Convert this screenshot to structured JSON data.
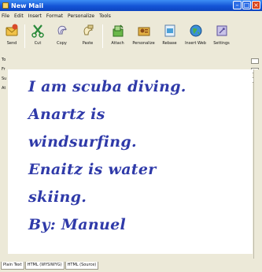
{
  "window": {
    "title": "New Mail"
  },
  "menubar": [
    "File",
    "Edit",
    "Insert",
    "Format",
    "Personalize",
    "Tools"
  ],
  "toolbar": [
    {
      "label": "Send",
      "icon": "send-icon"
    },
    {
      "label": "Cut",
      "icon": "cut-icon"
    },
    {
      "label": "Copy",
      "icon": "copy-icon"
    },
    {
      "label": "Paste",
      "icon": "paste-icon"
    },
    {
      "label": "Attach",
      "icon": "attach-icon"
    },
    {
      "label": "Personalize",
      "icon": "personalize-icon"
    },
    {
      "label": "Rebase",
      "icon": "rebase-icon"
    },
    {
      "label": "Insert Web",
      "icon": "insert-web-icon"
    },
    {
      "label": "Settings",
      "icon": "settings-icon"
    }
  ],
  "headers": [
    "To",
    "Fr",
    "Su",
    "At"
  ],
  "message": {
    "lines": [
      "I am scuba diving.",
      "Anartz is",
      "windsurfing.",
      "Enaitz is water",
      "skiing.",
      "By: Manuel"
    ],
    "color": "#2f3aa9"
  },
  "tabs": [
    "Plain Text",
    "HTML (WYSIWYG)",
    "HTML (Source)"
  ]
}
